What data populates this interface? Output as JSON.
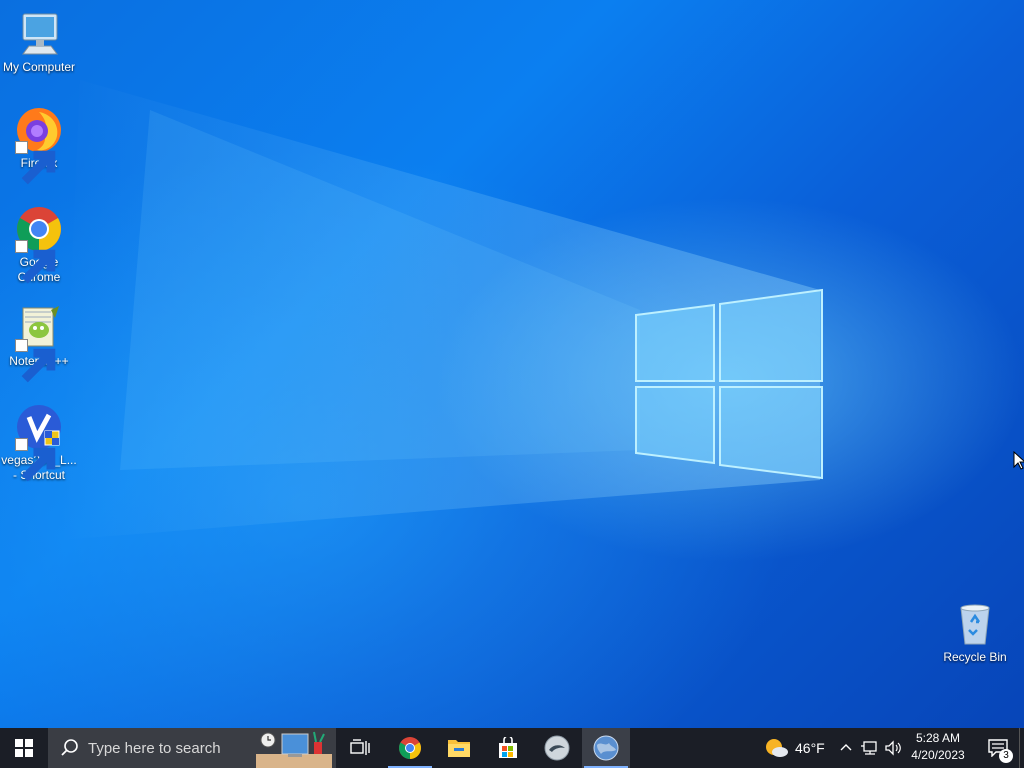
{
  "desktop": {
    "icons": [
      {
        "label": "My Computer",
        "icon": "computer-icon"
      },
      {
        "label": "Firefox",
        "icon": "firefox-icon"
      },
      {
        "label": "Google Chrome",
        "icon": "chrome-icon"
      },
      {
        "label": "Notepad++",
        "icon": "notepadpp-icon"
      },
      {
        "label": "vegas200_L...\n- Shortcut",
        "label_line1": "vegas200_L...",
        "label_line2": "- Shortcut",
        "icon": "vegas-icon"
      },
      {
        "label": "Recycle Bin",
        "icon": "recycle-bin-icon"
      }
    ]
  },
  "taskbar": {
    "search_placeholder": "Type here to search",
    "pinned": [
      "task-view-icon",
      "chrome-icon",
      "file-explorer-icon",
      "store-icon",
      "app-icon",
      "globe-app-icon"
    ],
    "weather": {
      "temp": "46°F",
      "icon": "partly-sunny-icon"
    },
    "clock": {
      "time": "5:28 AM",
      "date": "4/20/2023"
    },
    "notifications": {
      "count": "3"
    }
  },
  "colors": {
    "taskbar_bg": "#1b1e26",
    "search_bg": "#3a3d44",
    "accent": "#7fb2ff"
  }
}
